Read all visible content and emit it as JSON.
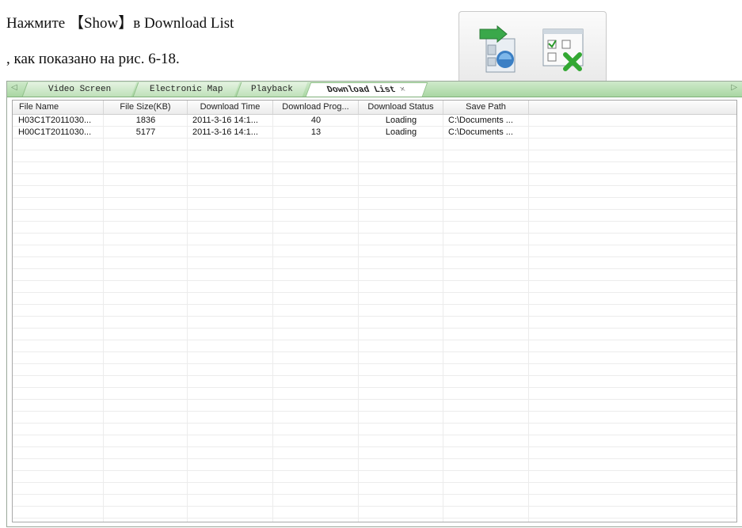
{
  "document": {
    "line1": "Нажмите 【Show】в Download List",
    "line2": ", как показано на рис. 6-18."
  },
  "toolbar_snippet": {
    "show_button_icon": "download-show-icon",
    "clear_button_icon": "download-clear-icon"
  },
  "tabs": [
    {
      "label": "Video Screen",
      "active": false
    },
    {
      "label": "Electronic Map",
      "active": false
    },
    {
      "label": "Playback",
      "active": false
    },
    {
      "label": "Download List",
      "active": true,
      "close": "×"
    }
  ],
  "download_list": {
    "columns": [
      "File Name",
      "File Size(KB)",
      "Download Time",
      "Download Prog...",
      "Download Status",
      "Save Path"
    ],
    "rows": [
      [
        "H03C1T2011030...",
        "1836",
        "2011-3-16 14:1...",
        "40",
        "Loading",
        "C:\\Documents ..."
      ],
      [
        "H00C1T2011030...",
        "5177",
        "2011-3-16 14:1...",
        "13",
        "Loading",
        "C:\\Documents ..."
      ]
    ]
  },
  "colors": {
    "tabbar_green": "#a9d6a2",
    "tab_active_bg": "#ffffff"
  }
}
